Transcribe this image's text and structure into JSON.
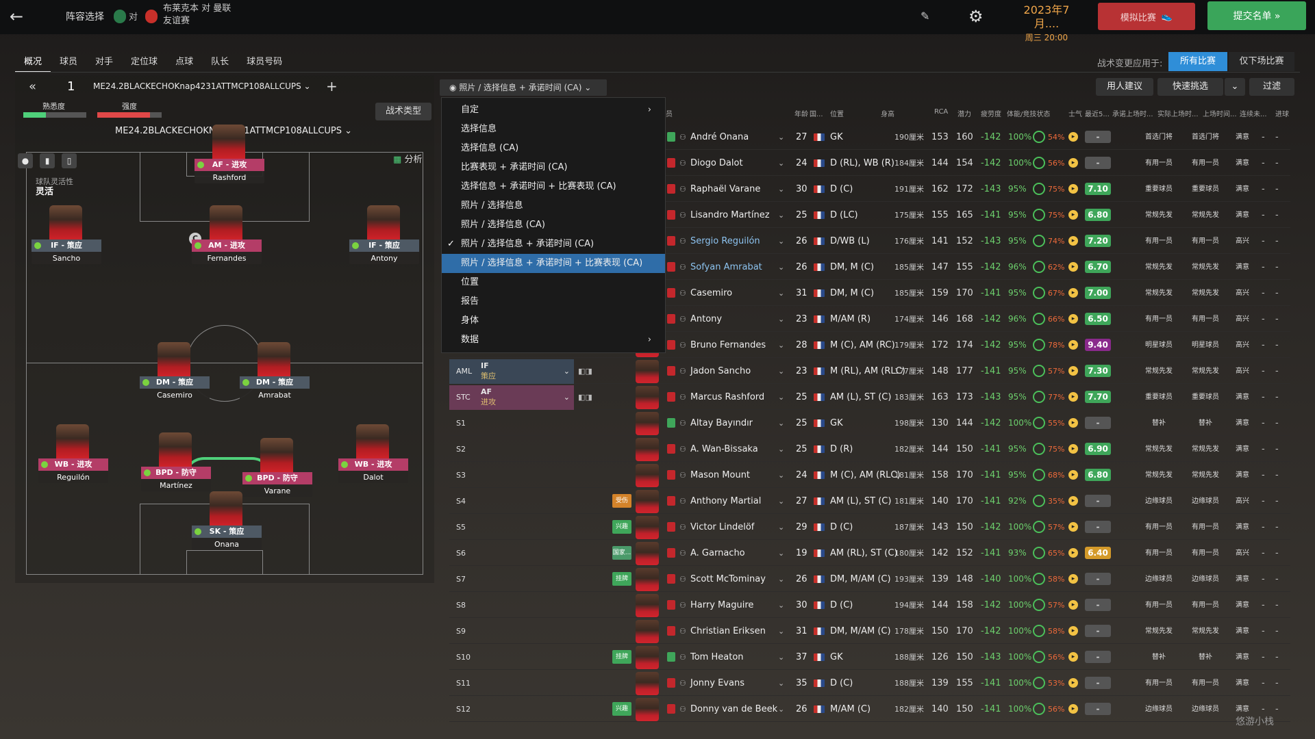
{
  "topbar": {
    "back": "←",
    "title": "阵容选择",
    "vs": "对",
    "match_line1": "布莱克本 对 曼联",
    "match_line2": "友谊赛",
    "date": "2023年7月....",
    "date_sub": "周三 20:00",
    "simulate": "模拟比赛",
    "submit": "提交名单 »"
  },
  "tabs": [
    "概况",
    "球员",
    "对手",
    "定位球",
    "点球",
    "队长",
    "球员号码"
  ],
  "tactic_apply": {
    "label": "战术变更应用于:",
    "all": "所有比赛",
    "next": "仅下场比赛"
  },
  "toolbar": {
    "double_chevron": "«",
    "slot": "1",
    "tactic_name": "ME24.2BLACKECHOKnap4231ATTMCP108ALLCUPS",
    "plus": "+",
    "familiarity": "熟悉度",
    "intensity": "强度",
    "tactic_name2": "ME24.2BLACKECHOKNAP4231ATTMCP108ALLCUPS",
    "tactic_type": "战术类型",
    "view": "照片 / 选择信息 + 承诺时间 (CA)",
    "recommend": "用人建议",
    "quick_pick": "快速挑选",
    "filter": "过滤"
  },
  "pitch": {
    "fluidity_label": "球队灵活性",
    "fluidity_value": "灵活",
    "analysis": "分析",
    "players": [
      {
        "role": "AF - 进攻",
        "name": "Rashford"
      },
      {
        "role": "IF - 策应",
        "name": "Sancho"
      },
      {
        "role": "AM - 进攻",
        "name": "Fernandes"
      },
      {
        "role": "IF - 策应",
        "name": "Antony"
      },
      {
        "role": "DM - 策应",
        "name": "Casemiro"
      },
      {
        "role": "DM - 策应",
        "name": "Amrabat"
      },
      {
        "role": "WB - 进攻",
        "name": "Reguilón"
      },
      {
        "role": "BPD - 防守",
        "name": "Martínez"
      },
      {
        "role": "BPD - 防守",
        "name": "Varane"
      },
      {
        "role": "WB - 进攻",
        "name": "Dalot"
      },
      {
        "role": "SK - 策应",
        "name": "Onana"
      }
    ]
  },
  "menu": {
    "items": [
      "自定",
      "选择信息",
      "选择信息 (CA)",
      "比赛表现 + 承诺时间 (CA)",
      "选择信息 + 承诺时间 + 比赛表现 (CA)",
      "照片 / 选择信息",
      "照片 / 选择信息 (CA)",
      "照片 / 选择信息 + 承诺时间 (CA)",
      "照片 / 选择信息 + 承诺时间 + 比赛表现 (CA)",
      "位置",
      "报告",
      "身体",
      "数据"
    ],
    "check": "✓",
    "arrow": "›"
  },
  "columns": {
    "name": "员",
    "age": "年龄",
    "nat": "国...",
    "pos": "位置",
    "height": "身高",
    "rca": "RCA",
    "pot": "潜力",
    "cond": "疲劳度",
    "fit": "体能/竞技状态",
    "morale": "士气",
    "rating": "最近5...",
    "st1": "承诺上场时...",
    "st2": "实际上场时...",
    "st3": "上场时间...",
    "inj": "连续未...",
    "yel": "进球"
  },
  "roster": [
    {
      "slot": "",
      "name": "André Onana",
      "age": "27",
      "pos": "GK",
      "ht": "190厘米",
      "rca": "153",
      "pot": "160",
      "neg": "-142",
      "fit": "100%",
      "sharp": "54%",
      "rating": "-",
      "st1": "首选门将",
      "st2": "首选门将",
      "st3": "满意",
      "d1": "-",
      "d2": "-"
    },
    {
      "slot": "",
      "name": "Diogo Dalot",
      "age": "24",
      "pos": "D (RL), WB (R)",
      "ht": "184厘米",
      "rca": "144",
      "pot": "154",
      "neg": "-142",
      "fit": "100%",
      "sharp": "56%",
      "rating": "-",
      "st1": "有用一员",
      "st2": "有用一员",
      "st3": "满意",
      "d1": "-",
      "d2": "-"
    },
    {
      "slot": "",
      "name": "Raphaël Varane",
      "age": "30",
      "pos": "D (C)",
      "ht": "191厘米",
      "rca": "162",
      "pot": "172",
      "neg": "-143",
      "fit": "95%",
      "sharp": "75%",
      "rating": "7.10",
      "st1": "重要球员",
      "st2": "重要球员",
      "st3": "满意",
      "d1": "-",
      "d2": "-"
    },
    {
      "slot": "",
      "name": "Lisandro Martínez",
      "age": "25",
      "pos": "D (LC)",
      "ht": "175厘米",
      "rca": "155",
      "pot": "165",
      "neg": "-141",
      "fit": "95%",
      "sharp": "75%",
      "rating": "6.80",
      "st1": "常规先发",
      "st2": "常规先发",
      "st3": "满意",
      "d1": "-",
      "d2": "-"
    },
    {
      "slot": "",
      "name": "Sergio Reguilón",
      "age": "26",
      "pos": "D/WB (L)",
      "ht": "176厘米",
      "rca": "141",
      "pot": "152",
      "neg": "-143",
      "fit": "95%",
      "sharp": "74%",
      "rating": "7.20",
      "st1": "有用一员",
      "st2": "有用一员",
      "st3": "高兴",
      "d1": "-",
      "d2": "-"
    },
    {
      "slot": "",
      "name": "Sofyan Amrabat",
      "age": "26",
      "pos": "DM, M (C)",
      "ht": "185厘米",
      "rca": "147",
      "pot": "155",
      "neg": "-142",
      "fit": "96%",
      "sharp": "62%",
      "rating": "6.70",
      "st1": "常规先发",
      "st2": "常规先发",
      "st3": "满意",
      "d1": "-",
      "d2": "-"
    },
    {
      "slot": "",
      "name": "Casemiro",
      "age": "31",
      "pos": "DM, M (C)",
      "ht": "185厘米",
      "rca": "159",
      "pot": "170",
      "neg": "-141",
      "fit": "95%",
      "sharp": "67%",
      "rating": "7.00",
      "st1": "常规先发",
      "st2": "常规先发",
      "st3": "高兴",
      "d1": "-",
      "d2": "-"
    },
    {
      "slot": "",
      "name": "Antony",
      "age": "23",
      "pos": "M/AM (R)",
      "ht": "174厘米",
      "rca": "146",
      "pot": "168",
      "neg": "-142",
      "fit": "96%",
      "sharp": "66%",
      "rating": "6.50",
      "st1": "有用一员",
      "st2": "有用一员",
      "st3": "高兴",
      "d1": "-",
      "d2": "-"
    },
    {
      "slot": "",
      "name": "Bruno Fernandes",
      "age": "28",
      "pos": "M (C), AM (RC)",
      "ht": "179厘米",
      "rca": "172",
      "pot": "174",
      "neg": "-142",
      "fit": "95%",
      "sharp": "78%",
      "rating": "9.40",
      "st1": "明星球员",
      "st2": "明星球员",
      "st3": "高兴",
      "d1": "-",
      "d2": "-"
    },
    {
      "slot": "AML",
      "role": "IF",
      "duty": "策应",
      "name": "Jadon Sancho",
      "age": "23",
      "pos": "M (RL), AM (RLC)",
      "ht": "177厘米",
      "rca": "148",
      "pot": "177",
      "neg": "-141",
      "fit": "95%",
      "sharp": "57%",
      "rating": "7.30",
      "st1": "常规先发",
      "st2": "常规先发",
      "st3": "高兴",
      "d1": "-",
      "d2": "-"
    },
    {
      "slot": "STC",
      "role": "AF",
      "duty": "进攻",
      "name": "Marcus Rashford",
      "age": "25",
      "pos": "AM (L), ST (C)",
      "ht": "183厘米",
      "rca": "163",
      "pot": "173",
      "neg": "-143",
      "fit": "95%",
      "sharp": "77%",
      "rating": "7.70",
      "st1": "重要球员",
      "st2": "重要球员",
      "st3": "满意",
      "d1": "-",
      "d2": "-"
    },
    {
      "slot": "S1",
      "name": "Altay Bayındır",
      "age": "25",
      "pos": "GK",
      "ht": "198厘米",
      "rca": "130",
      "pot": "144",
      "neg": "-142",
      "fit": "100%",
      "sharp": "55%",
      "rating": "-",
      "st1": "替补",
      "st2": "替补",
      "st3": "满意",
      "d1": "-",
      "d2": "-"
    },
    {
      "slot": "S2",
      "name": "A. Wan-Bissaka",
      "age": "25",
      "pos": "D (R)",
      "ht": "182厘米",
      "rca": "144",
      "pot": "150",
      "neg": "-141",
      "fit": "95%",
      "sharp": "75%",
      "rating": "6.90",
      "st1": "常规先发",
      "st2": "常规先发",
      "st3": "满意",
      "d1": "-",
      "d2": "-"
    },
    {
      "slot": "S3",
      "name": "Mason Mount",
      "age": "24",
      "pos": "M (C), AM (RLC)",
      "ht": "181厘米",
      "rca": "158",
      "pot": "170",
      "neg": "-141",
      "fit": "95%",
      "sharp": "68%",
      "rating": "6.80",
      "st1": "常规先发",
      "st2": "常规先发",
      "st3": "满意",
      "d1": "-",
      "d2": "-"
    },
    {
      "slot": "S4",
      "badge": "受伤",
      "name": "Anthony Martial",
      "age": "27",
      "pos": "AM (L), ST (C)",
      "ht": "181厘米",
      "rca": "140",
      "pot": "170",
      "neg": "-141",
      "fit": "92%",
      "sharp": "35%",
      "rating": "-",
      "st1": "边缘球员",
      "st2": "边缘球员",
      "st3": "高兴",
      "d1": "-",
      "d2": "-"
    },
    {
      "slot": "S5",
      "badge": "兴趣",
      "name": "Victor Lindelöf",
      "age": "29",
      "pos": "D (C)",
      "ht": "187厘米",
      "rca": "143",
      "pot": "150",
      "neg": "-142",
      "fit": "100%",
      "sharp": "57%",
      "rating": "-",
      "st1": "有用一员",
      "st2": "有用一员",
      "st3": "满意",
      "d1": "-",
      "d2": "-"
    },
    {
      "slot": "S6",
      "badge": "国家...",
      "name": "A. Garnacho",
      "age": "19",
      "pos": "AM (RL), ST (C)",
      "ht": "180厘米",
      "rca": "142",
      "pot": "152",
      "neg": "-141",
      "fit": "93%",
      "sharp": "65%",
      "rating": "6.40",
      "st1": "有用一员",
      "st2": "有用一员",
      "st3": "高兴",
      "d1": "-",
      "d2": "-"
    },
    {
      "slot": "S7",
      "badge": "挂牌",
      "name": "Scott McTominay",
      "age": "26",
      "pos": "DM, M/AM (C)",
      "ht": "193厘米",
      "rca": "139",
      "pot": "148",
      "neg": "-140",
      "fit": "100%",
      "sharp": "58%",
      "rating": "-",
      "st1": "边缘球员",
      "st2": "边缘球员",
      "st3": "满意",
      "d1": "-",
      "d2": "-"
    },
    {
      "slot": "S8",
      "name": "Harry Maguire",
      "age": "30",
      "pos": "D (C)",
      "ht": "194厘米",
      "rca": "144",
      "pot": "158",
      "neg": "-142",
      "fit": "100%",
      "sharp": "57%",
      "rating": "-",
      "st1": "有用一员",
      "st2": "有用一员",
      "st3": "满意",
      "d1": "-",
      "d2": "-"
    },
    {
      "slot": "S9",
      "name": "Christian Eriksen",
      "age": "31",
      "pos": "DM, M/AM (C)",
      "ht": "178厘米",
      "rca": "150",
      "pot": "170",
      "neg": "-142",
      "fit": "100%",
      "sharp": "58%",
      "rating": "-",
      "st1": "常规先发",
      "st2": "常规先发",
      "st3": "满意",
      "d1": "-",
      "d2": "-"
    },
    {
      "slot": "S10",
      "badge": "挂牌",
      "name": "Tom Heaton",
      "age": "37",
      "pos": "GK",
      "ht": "188厘米",
      "rca": "126",
      "pot": "150",
      "neg": "-143",
      "fit": "100%",
      "sharp": "56%",
      "rating": "-",
      "st1": "替补",
      "st2": "替补",
      "st3": "满意",
      "d1": "-",
      "d2": "-"
    },
    {
      "slot": "S11",
      "name": "Jonny Evans",
      "age": "35",
      "pos": "D (C)",
      "ht": "188厘米",
      "rca": "139",
      "pot": "155",
      "neg": "-141",
      "fit": "100%",
      "sharp": "53%",
      "rating": "-",
      "st1": "有用一员",
      "st2": "有用一员",
      "st3": "满意",
      "d1": "-",
      "d2": "-"
    },
    {
      "slot": "S12",
      "badge": "兴趣",
      "name": "Donny van de Beek",
      "age": "26",
      "pos": "M/AM (C)",
      "ht": "182厘米",
      "rca": "140",
      "pot": "150",
      "neg": "-141",
      "fit": "100%",
      "sharp": "56%",
      "rating": "-",
      "st1": "边缘球员",
      "st2": "边缘球员",
      "st3": "满意",
      "d1": "-",
      "d2": "-"
    }
  ],
  "watermark": "悠游小栈"
}
